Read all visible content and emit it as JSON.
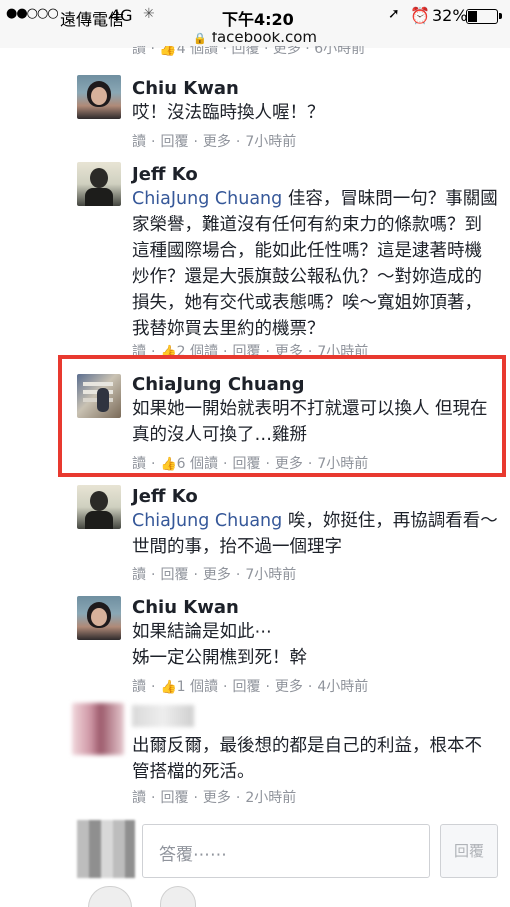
{
  "status_bar": {
    "signal": "●●○○○",
    "carrier": "遠傳電信",
    "network": "4G",
    "clock": "下午4:20",
    "battery_pct": "32%",
    "battery_level": 0.32
  },
  "url_bar": {
    "domain": "facebook.com"
  },
  "partial_meta": "讀 · 👍4 個讀 · 回覆 · 更多 · 6小時前",
  "comments": [
    {
      "author": "Chiu Kwan",
      "text": "哎！沒法臨時換人喔！？",
      "meta": {
        "read": "讀",
        "reply": "回覆",
        "more": "更多",
        "time": "7小時前"
      }
    },
    {
      "author": "Jeff Ko",
      "mention": "ChiaJung Chuang",
      "text": " 佳容，冒昧問一句？事關國家榮譽，難道沒有任何有約束力的條款嗎？到這種國際場合，能如此任性嗎？這是逮著時機炒作？還是大張旗鼓公報私仇？～對妳造成的損失，她有交代或表態嗎？唉～寬姐妳頂著，我替妳買去里約的機票？",
      "meta": {
        "read": "讀",
        "likes": "2 個讀",
        "reply": "回覆",
        "more": "更多",
        "time": "7小時前"
      }
    },
    {
      "author": "ChiaJung Chuang",
      "text": "如果她一開始就表明不打就還可以換人 但現在真的沒人可換了…雞掰",
      "meta": {
        "read": "讀",
        "likes": "6 個讀",
        "reply": "回覆",
        "more": "更多",
        "time": "7小時前"
      }
    },
    {
      "author": "Jeff Ko",
      "mention": "ChiaJung Chuang",
      "text": " 唉，妳挺住，再協調看看～世間的事，抬不過一個理字",
      "meta": {
        "read": "讀",
        "reply": "回覆",
        "more": "更多",
        "time": "7小時前"
      }
    },
    {
      "author": "Chiu Kwan",
      "text_lines": [
        "如果結論是如此⋯",
        "姊一定公開樵到死！幹"
      ],
      "meta": {
        "read": "讀",
        "likes": "1 個讀",
        "reply": "回覆",
        "more": "更多",
        "time": "4小時前"
      }
    },
    {
      "author": "",
      "text": "出爾反爾，最後想的都是自己的利益，根本不管搭檔的死活。",
      "meta": {
        "read": "讀",
        "reply": "回覆",
        "more": "更多",
        "time": "2小時前"
      }
    }
  ],
  "reply": {
    "placeholder": "答覆⋯⋯",
    "button": "回覆"
  },
  "colors": {
    "highlight": "#e8392f",
    "link": "#365899",
    "meta": "#90949c"
  }
}
